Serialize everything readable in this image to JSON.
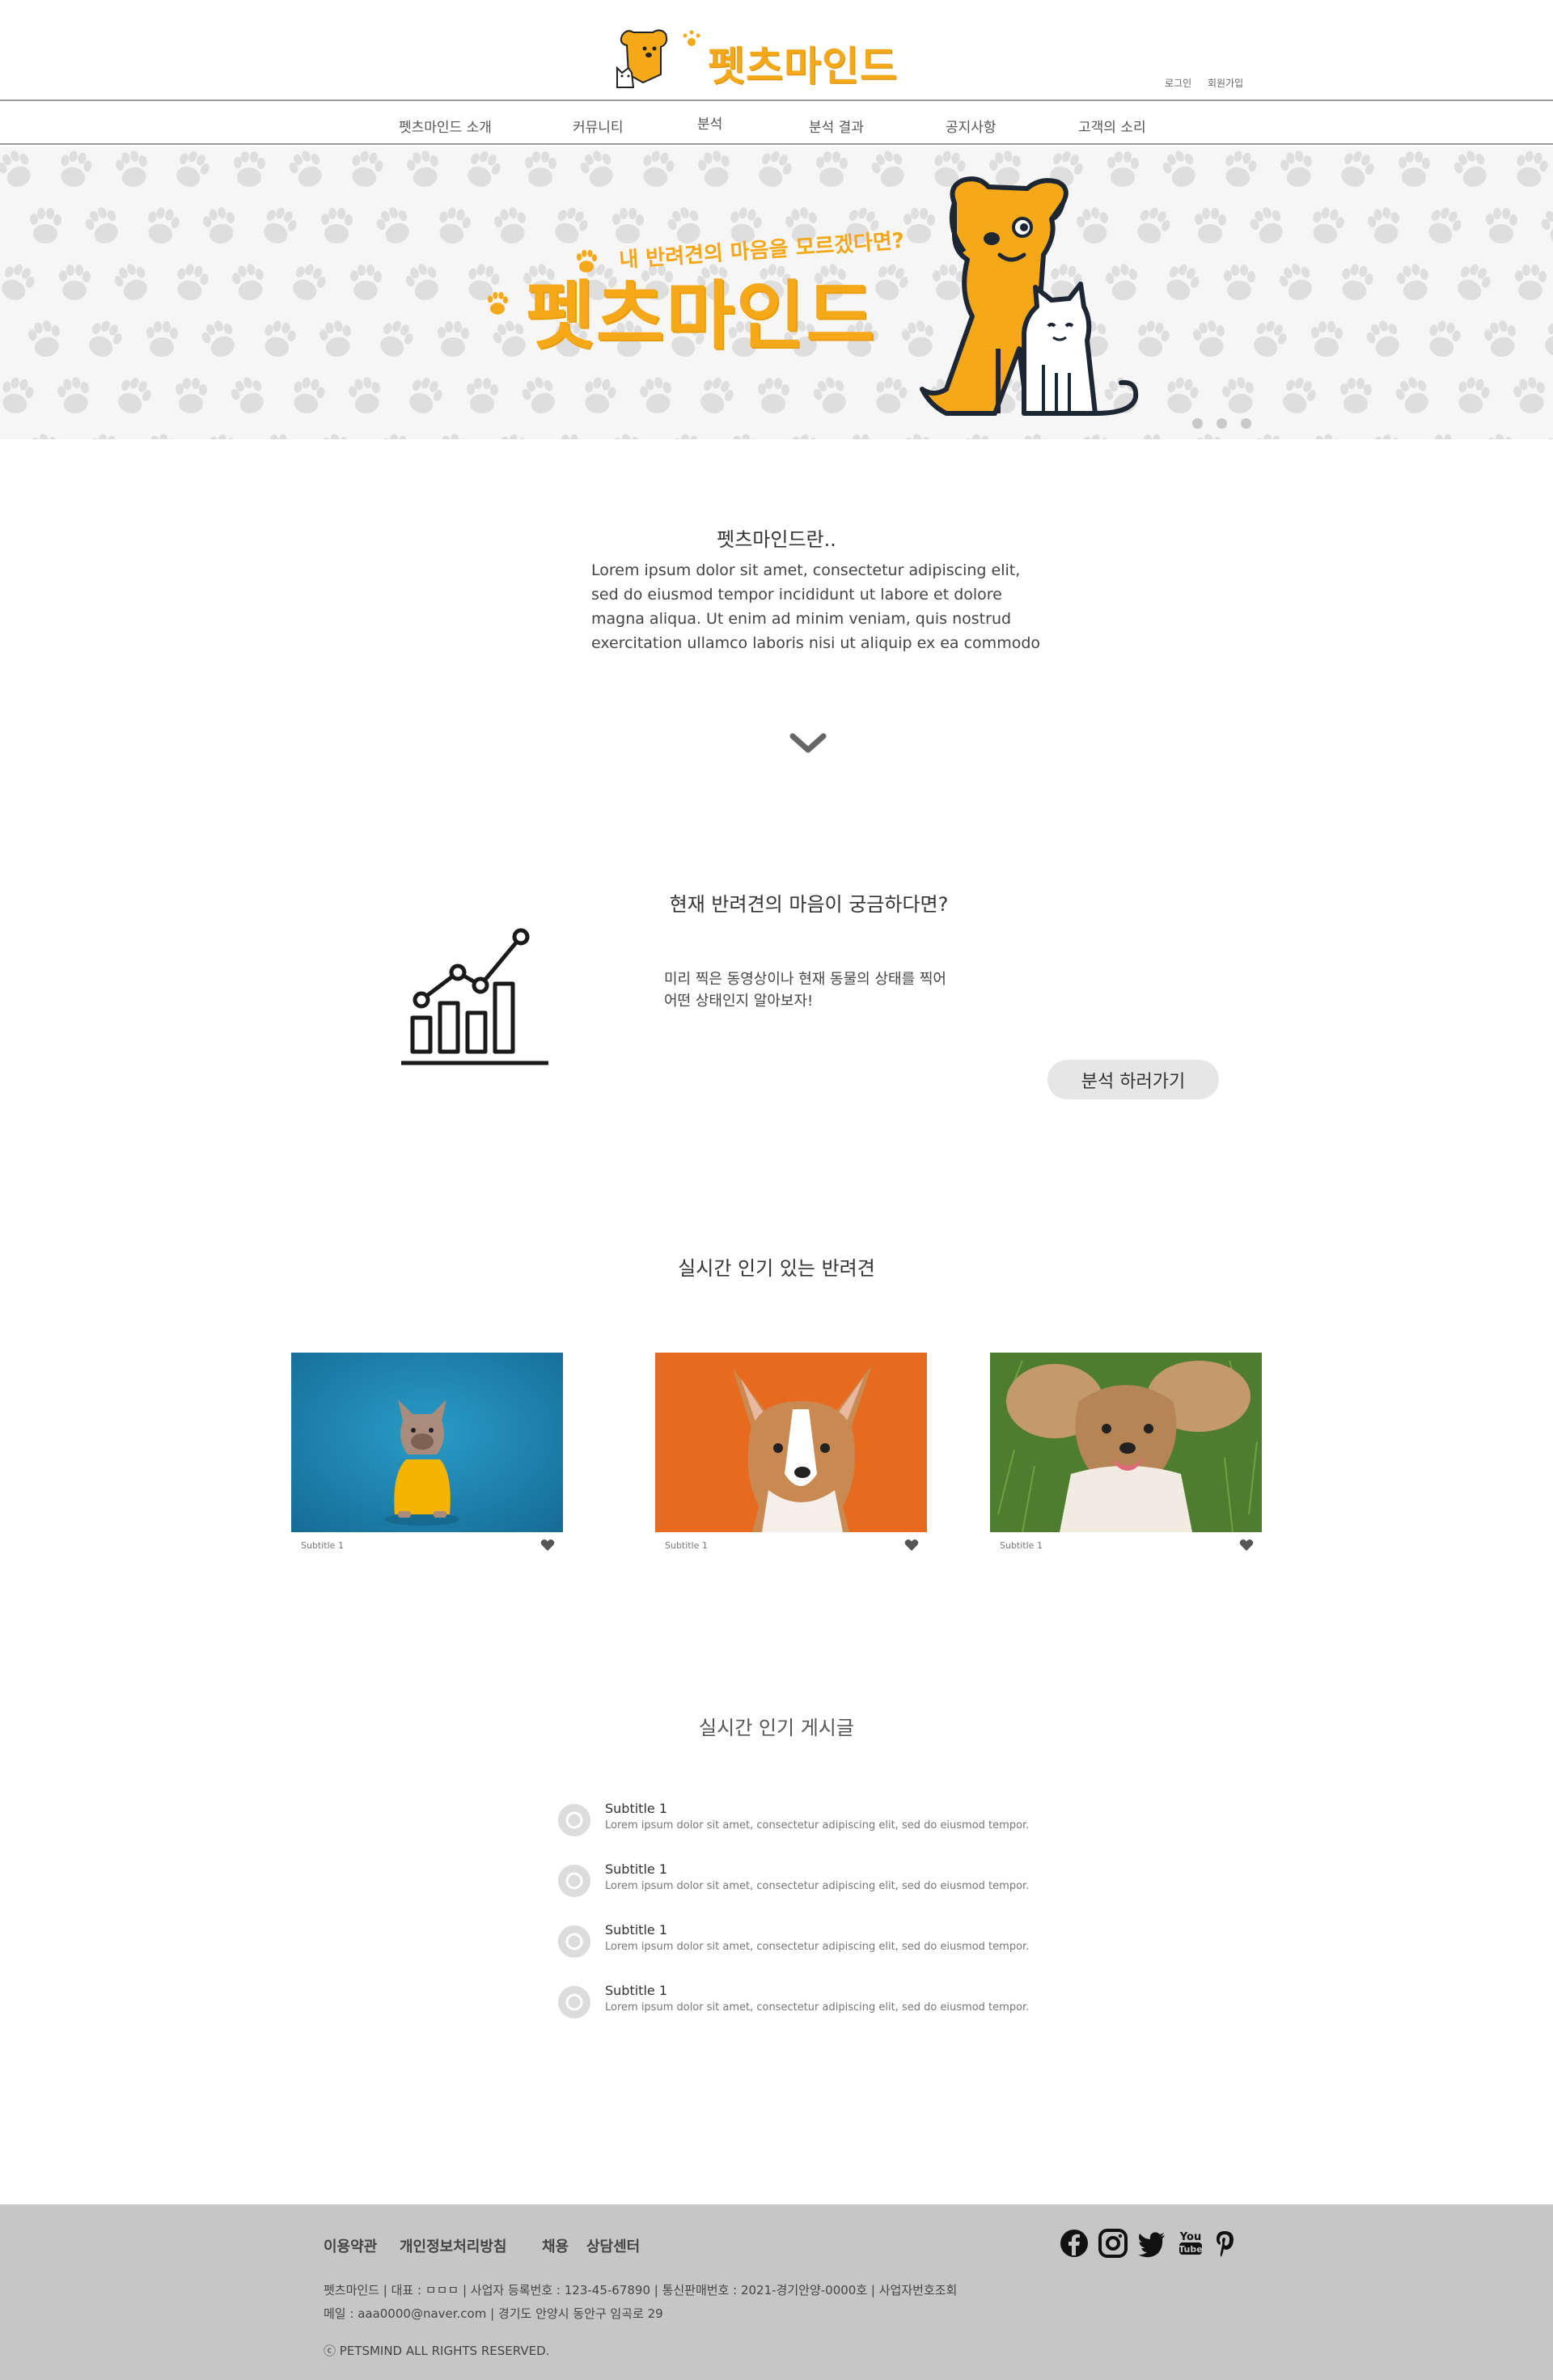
{
  "brand": {
    "logo_text": "펫츠마인드",
    "accent": "#f5a919"
  },
  "header": {
    "login": "로그인",
    "signup": "회원가입"
  },
  "nav": {
    "items": [
      "펫츠마인드 소개",
      "커뮤니티",
      "분석",
      "분석 결과",
      "공지사항",
      "고객의 소리"
    ]
  },
  "hero": {
    "subtitle": "내 반려견의 마음을 모르겠다면?",
    "title": "펫츠마인드",
    "slides": 3,
    "pattern_color": "#dadada"
  },
  "intro": {
    "title": "펫츠마인드란..",
    "lines": [
      "Lorem ipsum dolor sit amet, consectetur adipiscing elit,",
      "sed do eiusmod tempor incididunt ut labore et dolore",
      "magna aliqua. Ut enim ad minim veniam, quis nostrud",
      "exercitation ullamco laboris nisi ut aliquip ex ea commodo"
    ]
  },
  "analyze": {
    "title": "현재 반려견의 마음이 궁금하다면?",
    "lines": [
      "미리 찍은 동영상이나 현재 동물의 상태를 찍어",
      "어떤 상태인지 알아보자!"
    ],
    "button": "분석 하러가기"
  },
  "popular_dogs": {
    "title": "실시간 인기 있는  반려견",
    "cards": [
      {
        "subtitle": "Subtitle 1",
        "bg": "#1f86b3"
      },
      {
        "subtitle": "Subtitle 1",
        "bg": "#e86a1f"
      },
      {
        "subtitle": "Subtitle 1",
        "bg": "#5d8a3a"
      }
    ]
  },
  "popular_posts": {
    "title": "실시간 인기 게시글",
    "items": [
      {
        "title": "Subtitle 1",
        "desc": "Lorem ipsum dolor sit amet, consectetur adipiscing elit, sed do eiusmod tempor."
      },
      {
        "title": "Subtitle 1",
        "desc": "Lorem ipsum dolor sit amet, consectetur adipiscing elit, sed do eiusmod tempor."
      },
      {
        "title": "Subtitle 1",
        "desc": "Lorem ipsum dolor sit amet, consectetur adipiscing elit, sed do eiusmod tempor."
      },
      {
        "title": "Subtitle 1",
        "desc": "Lorem ipsum dolor sit amet, consectetur adipiscing elit, sed do eiusmod tempor."
      }
    ]
  },
  "footer": {
    "links": [
      "이용약관",
      "개인정보처리방침",
      "채용",
      "상담센터"
    ],
    "info1": "펫츠마인드 | 대표 : ㅁㅁㅁ | 사업자 등록번호 : 123-45-67890 | 통신판매번호 : 2021-경기안양-0000호 | 사업자번호조회",
    "info2": "메일 : aaa0000@naver.com | 경기도 안양시 동안구 임곡로 29",
    "copyright": "ⓒ PETSMIND ALL RIGHTS RESERVED.",
    "social": [
      "facebook-icon",
      "instagram-icon",
      "twitter-icon",
      "youtube-icon",
      "pinterest-icon"
    ]
  }
}
